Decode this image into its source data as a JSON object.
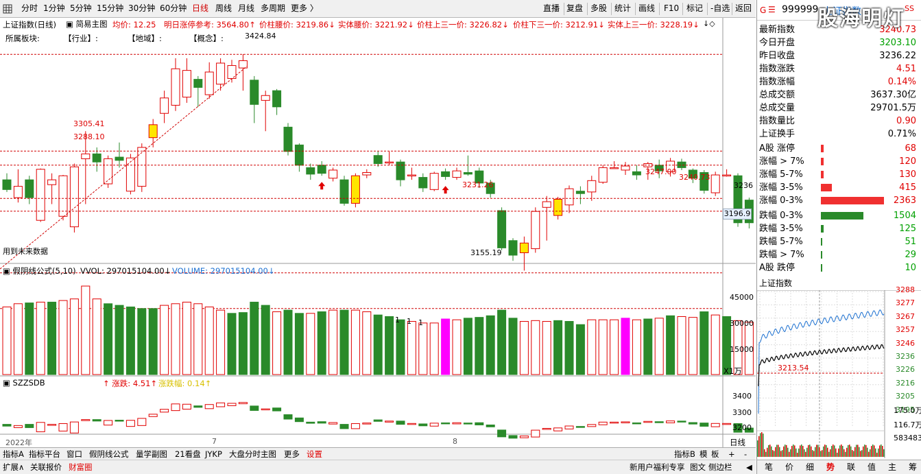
{
  "toolbar": {
    "grid_icon": "grid-icon",
    "periods": [
      "分时",
      "1分钟",
      "5分钟",
      "15分钟",
      "30分钟",
      "60分钟",
      "日线",
      "周线",
      "月线",
      "多周期",
      "更多 〉"
    ],
    "active": "日线",
    "right": [
      "直播",
      "复盘",
      "多股",
      "统计",
      "画线",
      "F10",
      "标记",
      "-自选",
      "返回"
    ]
  },
  "title_row": {
    "name": "上证指数(日线)",
    "theme": "简易主图",
    "avg": "均价: 12.25",
    "limit": "明日涨停参考: 3564.80↑",
    "mid": "价柱腰价: 3219.86↓",
    "body_mid": "实体腰价: 3221.92↓",
    "upper": "价柱上三一价: 3226.82↓",
    "lower": "价柱下三一价: 3212.91↓",
    "body_upper": "实体上三一价: 3228.19↓"
  },
  "sector_row": {
    "label": "所属板块:",
    "industry": "【行业】:",
    "region": "【地域】:",
    "concept": "【概念】:"
  },
  "annotations": {
    "high": "3424.84",
    "low": "3155.19",
    "p3305": "3305.41",
    "p3288": "3288.10",
    "p3231": "3231.26",
    "p3247": "3247.00",
    "p3240": "3240.73",
    "future": "用到未来数据"
  },
  "price_axis": {
    "mark": "3236",
    "current": "3196.9"
  },
  "vol_row": {
    "name": "假阴线公式(5,10)",
    "vvol": "VVOL: 297015104.00↓",
    "volume": "VOLUME: 297015104.00↓",
    "ticks": [
      "45000",
      "30000",
      "15000"
    ],
    "unit": "X1万",
    "ones": [
      "1",
      "1",
      "1"
    ]
  },
  "sz_row": {
    "name": "SZZSDB",
    "change": "↑ 涨跌: 4.51↑",
    "pct": "涨跌幅: 0.14↑",
    "ticks": [
      "3400",
      "3300",
      "3200"
    ]
  },
  "date_axis": {
    "year": "2022年",
    "m7": "7",
    "m8": "8",
    "period": "日线"
  },
  "footer": {
    "items": [
      "指标A",
      "指标平台",
      "窗口",
      "假阴线公式",
      "量学副图",
      "21看盘",
      "JYKP",
      "大盘分时主图",
      "更多",
      "设置"
    ],
    "active": "设置",
    "right": [
      "指标B",
      "模",
      "板",
      "+",
      "-"
    ]
  },
  "footer2": {
    "items": [
      "扩展∧",
      "关联报价",
      "财富圈"
    ],
    "right": [
      "新用户福利专享",
      "图文",
      "侧边栏",
      "◀"
    ]
  },
  "side": {
    "code": "999999",
    "name": "上证指数",
    "brand": "股海明灯",
    "quotes": [
      {
        "l": "最新指数",
        "v": "3240.73",
        "c": "red"
      },
      {
        "l": "今日开盘",
        "v": "3203.10",
        "c": "grn"
      },
      {
        "l": "昨日收盘",
        "v": "3236.22",
        "c": ""
      },
      {
        "l": "指数涨跌",
        "v": "4.51",
        "c": "red"
      },
      {
        "l": "指数涨幅",
        "v": "0.14%",
        "c": "red"
      },
      {
        "l": "总成交额",
        "v": "3637.30亿",
        "c": ""
      },
      {
        "l": "总成交量",
        "v": "29701.5万",
        "c": ""
      },
      {
        "l": "指数量比",
        "v": "0.90",
        "c": "red"
      },
      {
        "l": "上证换手",
        "v": "0.71%",
        "c": ""
      }
    ],
    "breadth": [
      {
        "l": "A股 涨停",
        "v": "68",
        "c": "red",
        "w": 4
      },
      {
        "l": "涨幅 > 7%",
        "v": "120",
        "c": "red",
        "w": 4
      },
      {
        "l": "涨幅 5-7%",
        "v": "130",
        "c": "red",
        "w": 4
      },
      {
        "l": "涨幅 3-5%",
        "v": "415",
        "c": "red",
        "w": 16
      },
      {
        "l": "涨幅 0-3%",
        "v": "2363",
        "c": "red",
        "w": 92
      },
      {
        "l": "跌幅 0-3%",
        "v": "1504",
        "c": "grn",
        "w": 62
      },
      {
        "l": "跌幅 3-5%",
        "v": "125",
        "c": "grn",
        "w": 4
      },
      {
        "l": "跌幅 5-7%",
        "v": "51",
        "c": "grn",
        "w": 2
      },
      {
        "l": "跌幅 > 7%",
        "v": "29",
        "c": "grn",
        "w": 2
      },
      {
        "l": "A股 跌停",
        "v": "10",
        "c": "grn",
        "w": 2
      }
    ],
    "mini_title": "上证指数",
    "mini_ticks": [
      "3288",
      "3277",
      "3267",
      "3257",
      "3246",
      "3236",
      "3226",
      "3216",
      "3205",
      "3195"
    ],
    "mini_vol": [
      "175.0万",
      "116.7万",
      "583483"
    ],
    "mini_open": "3213.54",
    "tabs": [
      "笔",
      "价",
      "细",
      "势",
      "联",
      "值",
      "主",
      "筹"
    ],
    "active_tab": "势"
  },
  "chart_data": {
    "type": "candlestick",
    "series": [
      [
        3270,
        3258,
        3278,
        3255
      ],
      [
        3248,
        3262,
        3283,
        3242
      ],
      [
        3270,
        3248,
        3275,
        3240
      ],
      [
        3220,
        3283,
        3284,
        3218
      ],
      [
        3264,
        3270,
        3278,
        3240
      ],
      [
        3225,
        3275,
        3276,
        3220
      ],
      [
        3212,
        3286,
        3290,
        3205
      ],
      [
        3296,
        3302,
        3330,
        3240
      ],
      [
        3302,
        3292,
        3310,
        3280
      ],
      [
        3265,
        3296,
        3300,
        3260
      ],
      [
        3298,
        3294,
        3316,
        3285
      ],
      [
        3256,
        3297,
        3302,
        3252
      ],
      [
        3262,
        3310,
        3315,
        3255
      ],
      [
        3322,
        3338,
        3345,
        3310
      ],
      [
        3352,
        3371,
        3380,
        3340
      ],
      [
        3362,
        3407,
        3420,
        3355
      ],
      [
        3372,
        3405,
        3420,
        3365
      ],
      [
        3394,
        3384,
        3398,
        3360
      ],
      [
        3375,
        3403,
        3415,
        3370
      ],
      [
        3388,
        3414,
        3420,
        3380
      ],
      [
        3395,
        3411,
        3418,
        3390
      ],
      [
        3408,
        3417,
        3425,
        3380
      ],
      [
        3393,
        3363,
        3398,
        3340
      ],
      [
        3368,
        3374,
        3380,
        3330
      ],
      [
        3380,
        3360,
        3382,
        3350
      ],
      [
        3335,
        3305,
        3340,
        3300
      ],
      [
        3313,
        3288,
        3315,
        3280
      ],
      [
        3285,
        3277,
        3290,
        3270
      ],
      [
        3288,
        3278,
        3293,
        3275
      ],
      [
        3272,
        3282,
        3285,
        3268
      ],
      [
        3270,
        3241,
        3275,
        3238
      ],
      [
        3241,
        3275,
        3278,
        3236
      ],
      [
        3276,
        3279,
        3283,
        3272
      ],
      [
        3300,
        3290,
        3305,
        3286
      ],
      [
        3292,
        3292,
        3305,
        3288
      ],
      [
        3292,
        3270,
        3295,
        3262
      ],
      [
        3276,
        3276,
        3285,
        3270
      ],
      [
        3273,
        3260,
        3278,
        3255
      ],
      [
        3258,
        3278,
        3280,
        3256
      ],
      [
        3280,
        3274,
        3284,
        3270
      ],
      [
        3273,
        3281,
        3285,
        3270
      ],
      [
        3279,
        3277,
        3300,
        3275
      ],
      [
        3281,
        3266,
        3285,
        3260
      ],
      [
        3266,
        3253,
        3270,
        3248
      ],
      [
        3232,
        3186,
        3236,
        3183
      ],
      [
        3195,
        3177,
        3198,
        3170
      ],
      [
        3180,
        3192,
        3200,
        3158
      ],
      [
        3185,
        3231,
        3236,
        3180
      ],
      [
        3236,
        3243,
        3250,
        3195
      ],
      [
        3226,
        3246,
        3249,
        3221
      ],
      [
        3239,
        3259,
        3263,
        3229
      ],
      [
        3256,
        3253,
        3262,
        3240
      ],
      [
        3255,
        3269,
        3275,
        3244
      ],
      [
        3267,
        3285,
        3288,
        3265
      ],
      [
        3285,
        3285,
        3293,
        3284
      ],
      [
        3282,
        3287,
        3292,
        3276
      ],
      [
        3280,
        3276,
        3288,
        3270
      ],
      [
        3286,
        3290,
        3292,
        3270
      ],
      [
        3288,
        3281,
        3295,
        3272
      ],
      [
        3280,
        3293,
        3297,
        3274
      ],
      [
        3292,
        3285,
        3296,
        3282
      ],
      [
        3282,
        3272,
        3284,
        3266
      ],
      [
        3279,
        3257,
        3282,
        3253
      ],
      [
        3254,
        3276,
        3280,
        3250
      ],
      [
        3276,
        3276,
        3283,
        3274
      ],
      [
        3275,
        3217,
        3278,
        3212
      ],
      [
        3245,
        3217,
        3248,
        3210
      ],
      [
        3245,
        3240,
        3250,
        3230
      ],
      [
        3210,
        3239,
        3242,
        3206
      ]
    ],
    "vol": [
      {
        "v": 31000,
        "c": "r"
      },
      {
        "v": 33000,
        "c": "r"
      },
      {
        "v": 33500,
        "c": "g"
      },
      {
        "v": 34000,
        "c": "r"
      },
      {
        "v": 34000,
        "c": "g"
      },
      {
        "v": 35000,
        "c": "r"
      },
      {
        "v": 36000,
        "c": "r"
      },
      {
        "v": 44000,
        "c": "r"
      },
      {
        "v": 36000,
        "c": "r"
      },
      {
        "v": 33000,
        "c": "g"
      },
      {
        "v": 32000,
        "c": "g"
      },
      {
        "v": 31000,
        "c": "g"
      },
      {
        "v": 30000,
        "c": "g"
      },
      {
        "v": 30000,
        "c": "g"
      },
      {
        "v": 32000,
        "c": "r"
      },
      {
        "v": 33000,
        "c": "r"
      },
      {
        "v": 34000,
        "c": "r"
      },
      {
        "v": 33000,
        "c": "r"
      },
      {
        "v": 31000,
        "c": "r"
      },
      {
        "v": 29000,
        "c": "r"
      },
      {
        "v": 27000,
        "c": "g"
      },
      {
        "v": 27500,
        "c": "g"
      },
      {
        "v": 34000,
        "c": "g"
      },
      {
        "v": 32000,
        "c": "g"
      },
      {
        "v": 28000,
        "c": "r"
      },
      {
        "v": 29000,
        "c": "g"
      },
      {
        "v": 27000,
        "c": "g"
      },
      {
        "v": 27000,
        "c": "r"
      },
      {
        "v": 28000,
        "c": "g"
      },
      {
        "v": 29000,
        "c": "r"
      },
      {
        "v": 29000,
        "c": "g"
      },
      {
        "v": 29000,
        "c": "r"
      },
      {
        "v": 28000,
        "c": "r"
      },
      {
        "v": 26000,
        "c": "g"
      },
      {
        "v": 25000,
        "c": "g"
      },
      {
        "v": 23000,
        "c": "g"
      },
      {
        "v": 22000,
        "c": "r"
      },
      {
        "v": 21000,
        "c": "r"
      },
      {
        "v": 21000,
        "c": "r"
      },
      {
        "v": 23500,
        "c": "m"
      },
      {
        "v": 23000,
        "c": "r"
      },
      {
        "v": 24000,
        "c": "g"
      },
      {
        "v": 24500,
        "c": "g"
      },
      {
        "v": 25500,
        "c": "g"
      },
      {
        "v": 29000,
        "c": "g"
      },
      {
        "v": 24000,
        "c": "g"
      },
      {
        "v": 22000,
        "c": "r"
      },
      {
        "v": 22500,
        "c": "r"
      },
      {
        "v": 22000,
        "c": "r"
      },
      {
        "v": 22500,
        "c": "g"
      },
      {
        "v": 22000,
        "c": "g"
      },
      {
        "v": 20000,
        "c": "g"
      },
      {
        "v": 23000,
        "c": "r"
      },
      {
        "v": 23000,
        "c": "r"
      },
      {
        "v": 23000,
        "c": "r"
      },
      {
        "v": 24000,
        "c": "m"
      },
      {
        "v": 23000,
        "c": "r"
      },
      {
        "v": 23500,
        "c": "g"
      },
      {
        "v": 24000,
        "c": "r"
      },
      {
        "v": 25500,
        "c": "g"
      },
      {
        "v": 25000,
        "c": "r"
      },
      {
        "v": 24500,
        "c": "r"
      },
      {
        "v": 28000,
        "c": "g"
      },
      {
        "v": 26000,
        "c": "r"
      },
      {
        "v": 25000,
        "c": "g"
      },
      {
        "v": 22500,
        "c": "r"
      },
      {
        "v": 21500,
        "c": "r"
      },
      {
        "v": 20000,
        "c": "r"
      },
      {
        "v": 19000,
        "c": "g"
      }
    ],
    "up_arrows": [
      28,
      39
    ],
    "ref_lines": [
      3424.84,
      3305.41,
      3288.1,
      3247,
      3231.26,
      3155.19
    ]
  }
}
